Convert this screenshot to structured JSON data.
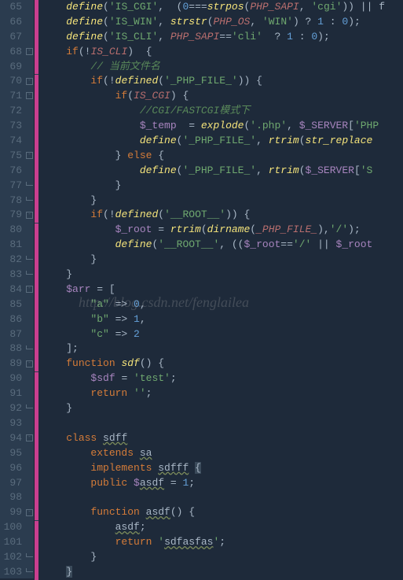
{
  "watermark": "http://blog.csdn.net/fenglailea",
  "lines": [
    {
      "n": 65,
      "change": true,
      "fold": "",
      "tokens": [
        [
          "op",
          "    "
        ],
        [
          "fn",
          "define"
        ],
        [
          "op",
          "("
        ],
        [
          "str",
          "'IS_CGI'"
        ],
        [
          "op",
          ",  ("
        ],
        [
          "num",
          "0"
        ],
        [
          "op",
          "==="
        ],
        [
          "fn",
          "strpos"
        ],
        [
          "op",
          "("
        ],
        [
          "const",
          "PHP_SAPI"
        ],
        [
          "op",
          ", "
        ],
        [
          "str",
          "'cgi'"
        ],
        [
          "op",
          ")) || "
        ],
        [
          "op",
          "f"
        ]
      ]
    },
    {
      "n": 66,
      "change": true,
      "fold": "",
      "tokens": [
        [
          "op",
          "    "
        ],
        [
          "fn",
          "define"
        ],
        [
          "op",
          "("
        ],
        [
          "str",
          "'IS_WIN'"
        ],
        [
          "op",
          ", "
        ],
        [
          "fn",
          "strstr"
        ],
        [
          "op",
          "("
        ],
        [
          "const",
          "PHP_OS"
        ],
        [
          "op",
          ", "
        ],
        [
          "str",
          "'WIN'"
        ],
        [
          "op",
          ") ? "
        ],
        [
          "num",
          "1"
        ],
        [
          "op",
          " : "
        ],
        [
          "num",
          "0"
        ],
        [
          "op",
          ");"
        ]
      ]
    },
    {
      "n": 67,
      "change": true,
      "fold": "",
      "tokens": [
        [
          "op",
          "    "
        ],
        [
          "fn",
          "define"
        ],
        [
          "op",
          "("
        ],
        [
          "str",
          "'IS_CLI'"
        ],
        [
          "op",
          ", "
        ],
        [
          "const",
          "PHP_SAPI"
        ],
        [
          "op",
          "=="
        ],
        [
          "str",
          "'cli'"
        ],
        [
          "op",
          "  ? "
        ],
        [
          "num",
          "1"
        ],
        [
          "op",
          " : "
        ],
        [
          "num",
          "0"
        ],
        [
          "op",
          ");"
        ]
      ]
    },
    {
      "n": 68,
      "change": true,
      "fold": "open",
      "tokens": [
        [
          "op",
          "    "
        ],
        [
          "kw",
          "if"
        ],
        [
          "op",
          "(!"
        ],
        [
          "const",
          "IS_CLI"
        ],
        [
          "op",
          ")  {"
        ]
      ]
    },
    {
      "n": 69,
      "change": true,
      "fold": "",
      "tokens": [
        [
          "op",
          "        "
        ],
        [
          "comment",
          "// 当前文件名"
        ]
      ]
    },
    {
      "n": 70,
      "change": true,
      "fold": "open",
      "tokens": [
        [
          "op",
          "        "
        ],
        [
          "kw",
          "if"
        ],
        [
          "op",
          "(!"
        ],
        [
          "fn",
          "defined"
        ],
        [
          "op",
          "("
        ],
        [
          "str",
          "'_PHP_FILE_'"
        ],
        [
          "op",
          ")) {"
        ]
      ]
    },
    {
      "n": 71,
      "change": true,
      "fold": "open",
      "tokens": [
        [
          "op",
          "            "
        ],
        [
          "kw",
          "if"
        ],
        [
          "op",
          "("
        ],
        [
          "const",
          "IS_CGI"
        ],
        [
          "op",
          ") {"
        ]
      ]
    },
    {
      "n": 72,
      "change": true,
      "fold": "",
      "tokens": [
        [
          "op",
          "                "
        ],
        [
          "comment",
          "//CGI/FASTCGI模式下"
        ]
      ]
    },
    {
      "n": 73,
      "change": true,
      "fold": "",
      "tokens": [
        [
          "op",
          "                "
        ],
        [
          "var",
          "$_temp"
        ],
        [
          "op",
          "  = "
        ],
        [
          "fn",
          "explode"
        ],
        [
          "op",
          "("
        ],
        [
          "str",
          "'.php'"
        ],
        [
          "op",
          ", "
        ],
        [
          "var",
          "$_SERVER"
        ],
        [
          "op",
          "["
        ],
        [
          "str",
          "'PHP"
        ]
      ]
    },
    {
      "n": 74,
      "change": true,
      "fold": "",
      "tokens": [
        [
          "op",
          "                "
        ],
        [
          "fn",
          "define"
        ],
        [
          "op",
          "("
        ],
        [
          "str",
          "'_PHP_FILE_'"
        ],
        [
          "op",
          ", "
        ],
        [
          "fn",
          "rtrim"
        ],
        [
          "op",
          "("
        ],
        [
          "fn",
          "str_replace"
        ]
      ]
    },
    {
      "n": 75,
      "change": true,
      "fold": "open",
      "tokens": [
        [
          "op",
          "            } "
        ],
        [
          "kw",
          "else"
        ],
        [
          "op",
          " {"
        ]
      ]
    },
    {
      "n": 76,
      "change": true,
      "fold": "",
      "tokens": [
        [
          "op",
          "                "
        ],
        [
          "fn",
          "define"
        ],
        [
          "op",
          "("
        ],
        [
          "str",
          "'_PHP_FILE_'"
        ],
        [
          "op",
          ", "
        ],
        [
          "fn",
          "rtrim"
        ],
        [
          "op",
          "("
        ],
        [
          "var",
          "$_SERVER"
        ],
        [
          "op",
          "["
        ],
        [
          "str",
          "'S"
        ]
      ]
    },
    {
      "n": 77,
      "change": true,
      "fold": "close",
      "tokens": [
        [
          "op",
          "            }"
        ]
      ]
    },
    {
      "n": 78,
      "change": true,
      "fold": "close",
      "tokens": [
        [
          "op",
          "        }"
        ]
      ]
    },
    {
      "n": 79,
      "change": true,
      "fold": "open",
      "tokens": [
        [
          "op",
          "        "
        ],
        [
          "kw",
          "if"
        ],
        [
          "op",
          "(!"
        ],
        [
          "fn",
          "defined"
        ],
        [
          "op",
          "("
        ],
        [
          "str",
          "'__ROOT__'"
        ],
        [
          "op",
          ")) {"
        ]
      ]
    },
    {
      "n": 80,
      "change": true,
      "fold": "",
      "tokens": [
        [
          "op",
          "            "
        ],
        [
          "var",
          "$_root"
        ],
        [
          "op",
          " = "
        ],
        [
          "fn",
          "rtrim"
        ],
        [
          "op",
          "("
        ],
        [
          "fn",
          "dirname"
        ],
        [
          "op",
          "("
        ],
        [
          "const",
          "_PHP_FILE_"
        ],
        [
          "op",
          "),"
        ],
        [
          "str",
          "'/'"
        ],
        [
          "op",
          ");"
        ]
      ]
    },
    {
      "n": 81,
      "change": true,
      "fold": "",
      "tokens": [
        [
          "op",
          "            "
        ],
        [
          "fn",
          "define"
        ],
        [
          "op",
          "("
        ],
        [
          "str",
          "'__ROOT__'"
        ],
        [
          "op",
          ", (("
        ],
        [
          "var",
          "$_root"
        ],
        [
          "op",
          "=="
        ],
        [
          "str",
          "'/'"
        ],
        [
          "op",
          " || "
        ],
        [
          "var",
          "$_root"
        ]
      ]
    },
    {
      "n": 82,
      "change": true,
      "fold": "close",
      "tokens": [
        [
          "op",
          "        }"
        ]
      ]
    },
    {
      "n": 83,
      "change": true,
      "fold": "close",
      "tokens": [
        [
          "op",
          "    }"
        ]
      ]
    },
    {
      "n": 84,
      "change": true,
      "fold": "open",
      "tokens": [
        [
          "op",
          "    "
        ],
        [
          "var",
          "$arr"
        ],
        [
          "op",
          " = ["
        ]
      ]
    },
    {
      "n": 85,
      "change": true,
      "fold": "",
      "tokens": [
        [
          "op",
          "        "
        ],
        [
          "str",
          "\"a\""
        ],
        [
          "op",
          " => "
        ],
        [
          "num",
          "0"
        ],
        [
          "op",
          ","
        ]
      ]
    },
    {
      "n": 86,
      "change": true,
      "fold": "",
      "tokens": [
        [
          "op",
          "        "
        ],
        [
          "str",
          "\"b\""
        ],
        [
          "op",
          " => "
        ],
        [
          "num",
          "1"
        ],
        [
          "op",
          ","
        ]
      ]
    },
    {
      "n": 87,
      "change": true,
      "fold": "",
      "tokens": [
        [
          "op",
          "        "
        ],
        [
          "str",
          "\"c\""
        ],
        [
          "op",
          " => "
        ],
        [
          "num",
          "2"
        ]
      ]
    },
    {
      "n": 88,
      "change": true,
      "fold": "close",
      "tokens": [
        [
          "op",
          "    ];"
        ]
      ]
    },
    {
      "n": 89,
      "change": true,
      "fold": "open",
      "tokens": [
        [
          "op",
          "    "
        ],
        [
          "kw",
          "function"
        ],
        [
          "op",
          " "
        ],
        [
          "fn",
          "sdf"
        ],
        [
          "op",
          "() {"
        ]
      ]
    },
    {
      "n": 90,
      "change": true,
      "fold": "",
      "tokens": [
        [
          "op",
          "        "
        ],
        [
          "var",
          "$sdf"
        ],
        [
          "op",
          " = "
        ],
        [
          "str",
          "'test'"
        ],
        [
          "op",
          ";"
        ]
      ]
    },
    {
      "n": 91,
      "change": true,
      "fold": "",
      "tokens": [
        [
          "op",
          "        "
        ],
        [
          "kw",
          "return"
        ],
        [
          "op",
          " "
        ],
        [
          "str",
          "''"
        ],
        [
          "op",
          ";"
        ]
      ]
    },
    {
      "n": 92,
      "change": true,
      "fold": "close",
      "tokens": [
        [
          "op",
          "    }"
        ]
      ]
    },
    {
      "n": 93,
      "change": true,
      "fold": "",
      "tokens": [
        [
          "op",
          ""
        ]
      ]
    },
    {
      "n": 94,
      "change": true,
      "fold": "open",
      "tokens": [
        [
          "op",
          "    "
        ],
        [
          "kw",
          "class"
        ],
        [
          "op",
          " "
        ],
        [
          "cls",
          "sdff"
        ]
      ]
    },
    {
      "n": 95,
      "change": true,
      "fold": "",
      "tokens": [
        [
          "op",
          "        "
        ],
        [
          "kw",
          "extends"
        ],
        [
          "op",
          " "
        ],
        [
          "cls",
          "sa"
        ]
      ]
    },
    {
      "n": 96,
      "change": true,
      "fold": "",
      "tokens": [
        [
          "op",
          "        "
        ],
        [
          "kw",
          "implements"
        ],
        [
          "op",
          " "
        ],
        [
          "cls",
          "sdfff"
        ],
        [
          "op",
          " "
        ],
        [
          "box",
          "{"
        ]
      ]
    },
    {
      "n": 97,
      "change": true,
      "fold": "",
      "tokens": [
        [
          "op",
          "        "
        ],
        [
          "kw",
          "public"
        ],
        [
          "op",
          " "
        ],
        [
          "var",
          "$"
        ],
        [
          "wavy",
          "asdf"
        ],
        [
          "op",
          " = "
        ],
        [
          "num",
          "1"
        ],
        [
          "op",
          ";"
        ]
      ]
    },
    {
      "n": 98,
      "change": true,
      "fold": "",
      "tokens": [
        [
          "op",
          ""
        ]
      ]
    },
    {
      "n": 99,
      "change": true,
      "fold": "open",
      "tokens": [
        [
          "op",
          "        "
        ],
        [
          "kw",
          "function"
        ],
        [
          "op",
          " "
        ],
        [
          "wavy",
          "asdf"
        ],
        [
          "op",
          "() {"
        ]
      ]
    },
    {
      "n": 100,
      "change": true,
      "fold": "",
      "tokens": [
        [
          "op",
          "            "
        ],
        [
          "wavy",
          "asdf"
        ],
        [
          "op",
          ";"
        ]
      ]
    },
    {
      "n": 101,
      "change": true,
      "fold": "",
      "tokens": [
        [
          "op",
          "            "
        ],
        [
          "kw",
          "return"
        ],
        [
          "op",
          " "
        ],
        [
          "str",
          "'"
        ],
        [
          "wavy",
          "sdfasfas"
        ],
        [
          "str",
          "'"
        ],
        [
          "op",
          ";"
        ]
      ]
    },
    {
      "n": 102,
      "change": true,
      "fold": "close",
      "tokens": [
        [
          "op",
          "        }"
        ]
      ]
    },
    {
      "n": 103,
      "change": true,
      "fold": "close",
      "tokens": [
        [
          "op",
          "    "
        ],
        [
          "box",
          "}"
        ]
      ]
    }
  ]
}
